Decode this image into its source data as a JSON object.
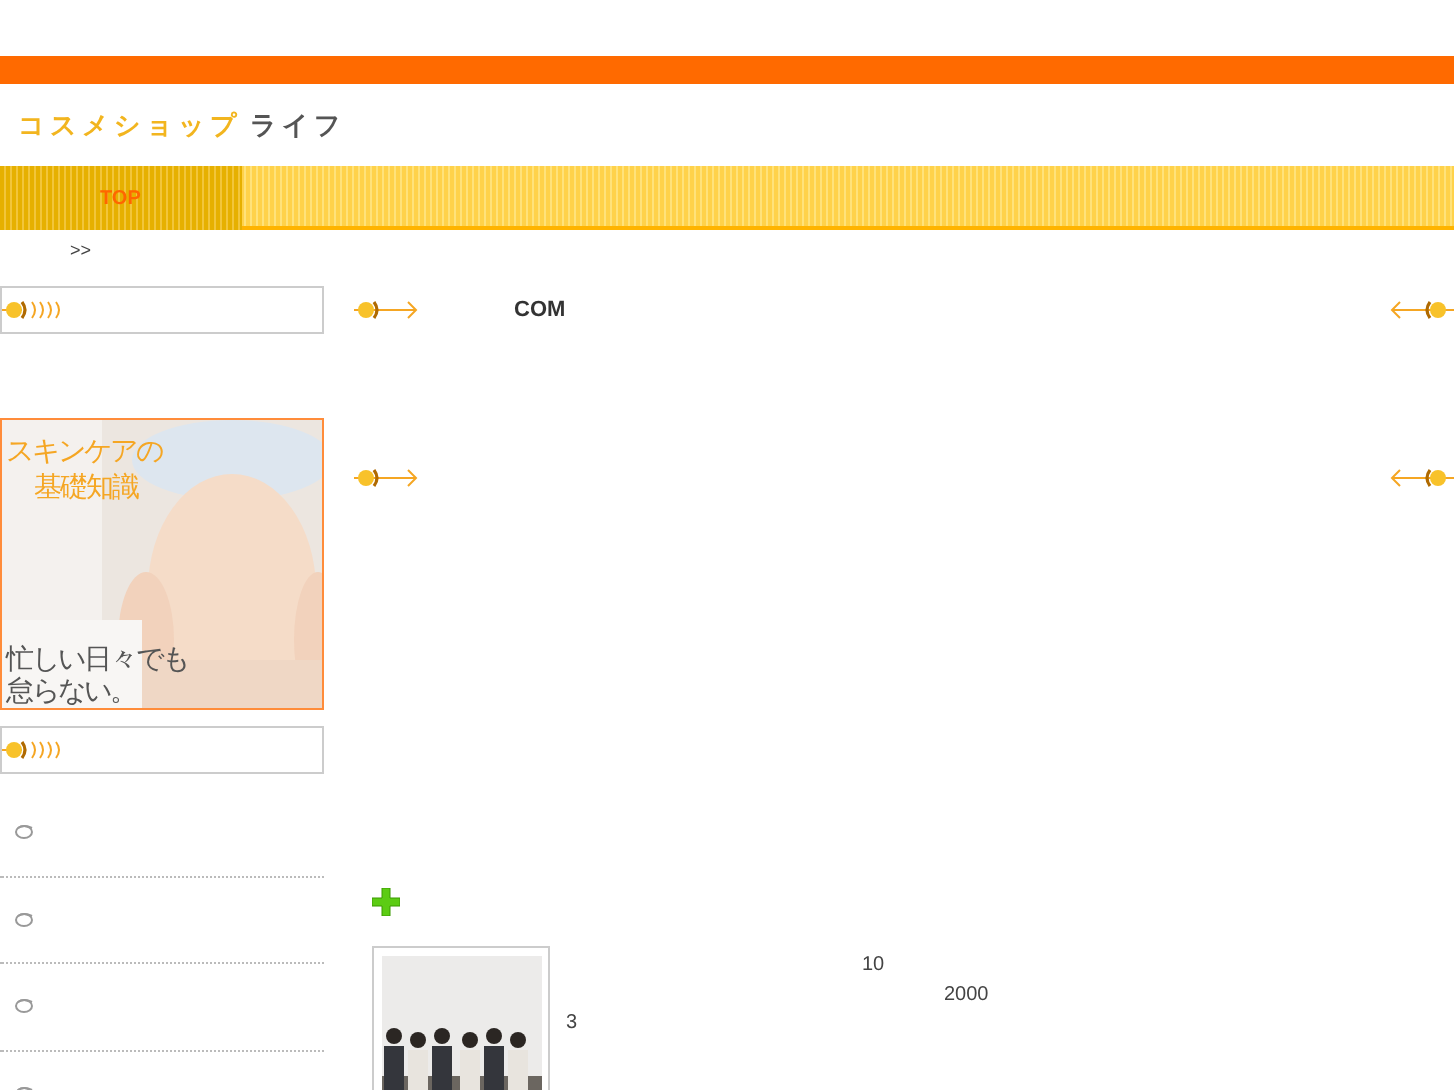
{
  "logo": {
    "part_1": "コスメショップ",
    "part_2": "ライフ"
  },
  "nav": [
    {
      "label": "TOP",
      "selected": true
    }
  ],
  "breadcrumb": ">>",
  "sidebar": {
    "banner": {
      "kind": "picture",
      "line_1": "スキンケアの",
      "line_2": "基礎知識",
      "line_3": "忙しい日々でも",
      "line_4": "怠らない。"
    },
    "list_items": [
      {
        "kind": "bullet"
      },
      {
        "kind": "bullet"
      },
      {
        "kind": "bullet"
      },
      {
        "kind": "bullet"
      }
    ]
  },
  "main": {
    "heading": "COM",
    "post": {
      "kind": "picture",
      "texts": [
        "10",
        "2000",
        "3"
      ]
    }
  }
}
